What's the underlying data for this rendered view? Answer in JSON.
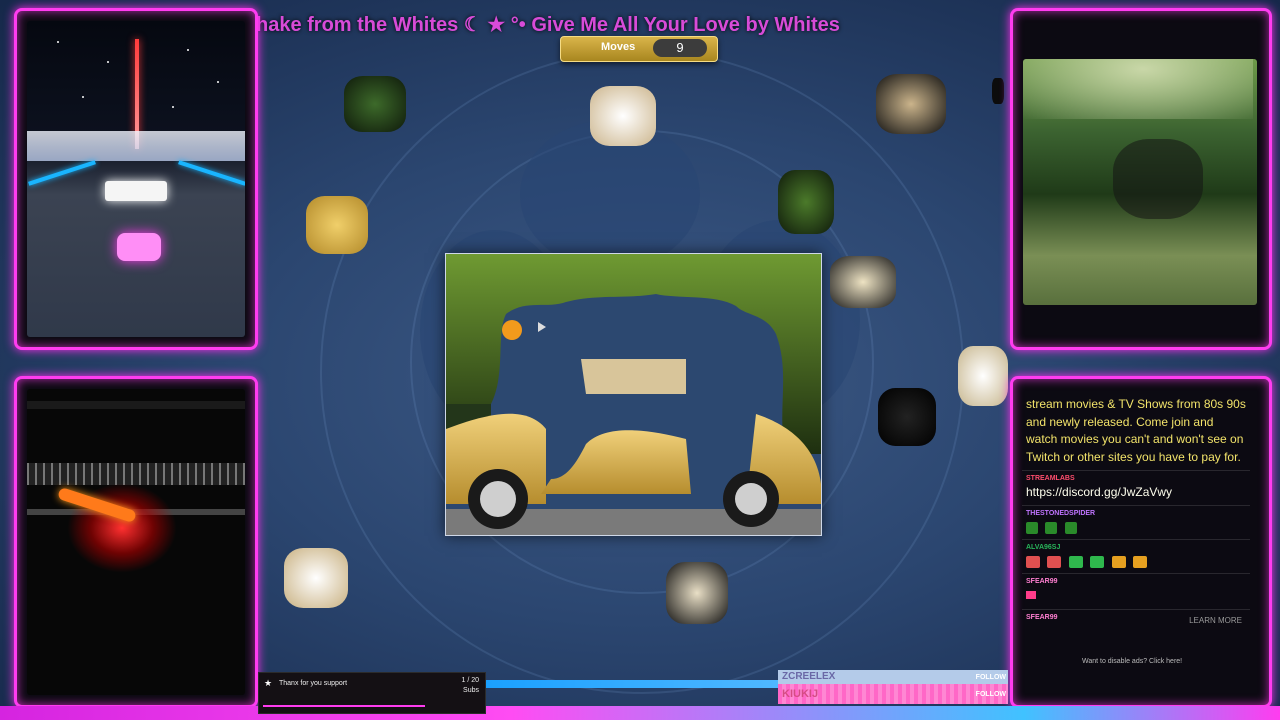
{
  "ticker": {
    "text": "hake from the Whites ☾ ★ °• Give Me All Your Love by Whites"
  },
  "moves": {
    "label": "Moves",
    "value": "9"
  },
  "chat": {
    "description": "stream movies & TV Shows from 80s 90s and newly released. Come join and watch movies you can't and won't see on Twitch or other sites you have to pay for.",
    "messages": [
      {
        "user": "STREAMLABS",
        "user_color": "#ff4d6d",
        "text": "https://discord.gg/JwZaVwy"
      },
      {
        "user": "THESTONEDSPIDER",
        "user_color": "#c074ff",
        "text": ""
      },
      {
        "user": "ALVA96SJ",
        "user_color": "#28b45a",
        "text": ""
      },
      {
        "user": "SFEAR99",
        "user_color": "#ff7fd1",
        "text": ""
      },
      {
        "user": "SFEAR99",
        "user_color": "#ff7fd1",
        "text": ""
      }
    ],
    "learn_more": "LEARN MORE",
    "ads_text": "Want to disable ads? Click here!"
  },
  "alert": {
    "text": "Thanx for you support",
    "count": "1 / 20",
    "unit": "Subs"
  },
  "follows": {
    "name1": "ZCREELEX",
    "name2": "KIUKIJ",
    "tag": "FOLLOW"
  },
  "colors": {
    "neon": "#ff3cf0",
    "gold": "#d9b54a",
    "board_bg": "#2c4870"
  }
}
